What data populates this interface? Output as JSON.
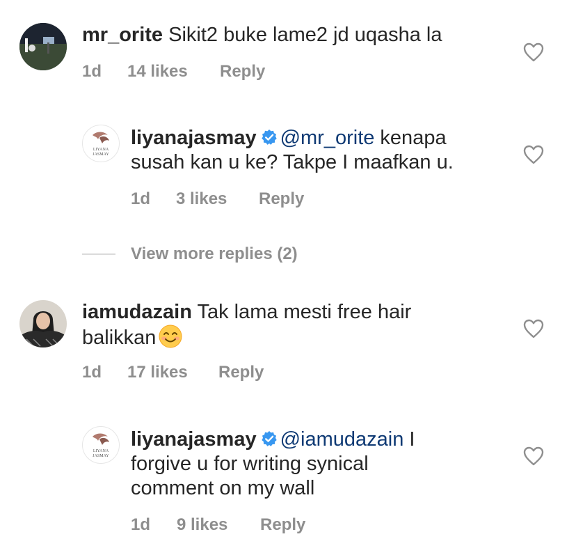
{
  "comments": [
    {
      "username": "mr_orite",
      "text": " Sikit2 buke lame2 jd uqasha la",
      "time": "1d",
      "likes": "14 likes",
      "reply_label": "Reply"
    },
    {
      "username": "liyanajasmay",
      "mention": "@mr_orite",
      "text_line1": " kenapa",
      "text_line2": "susah kan u ke? Takpe I maafkan u.",
      "time": "1d",
      "likes": "3 likes",
      "reply_label": "Reply",
      "avatar_text_1": "LIYANA",
      "avatar_text_2": "JASMAY"
    },
    {
      "username": "iamudazain",
      "text_line1": " Tak lama mesti free hair",
      "text_line2": "balikkan",
      "emoji": "smiling-face",
      "time": "1d",
      "likes": "17 likes",
      "reply_label": "Reply"
    },
    {
      "username": "liyanajasmay",
      "mention": "@iamudazain",
      "text_line1": " I",
      "text_line2": "forgive u for writing synical",
      "text_line3": "comment on my wall",
      "time": "1d",
      "likes": "9 likes",
      "reply_label": "Reply",
      "avatar_text_1": "LIYANA",
      "avatar_text_2": "JASMAY"
    }
  ],
  "view_more_replies": "View more replies (2)",
  "colors": {
    "text": "#262626",
    "meta": "#8e8e8e",
    "mention": "#0f3a74",
    "verified": "#3897f0"
  }
}
